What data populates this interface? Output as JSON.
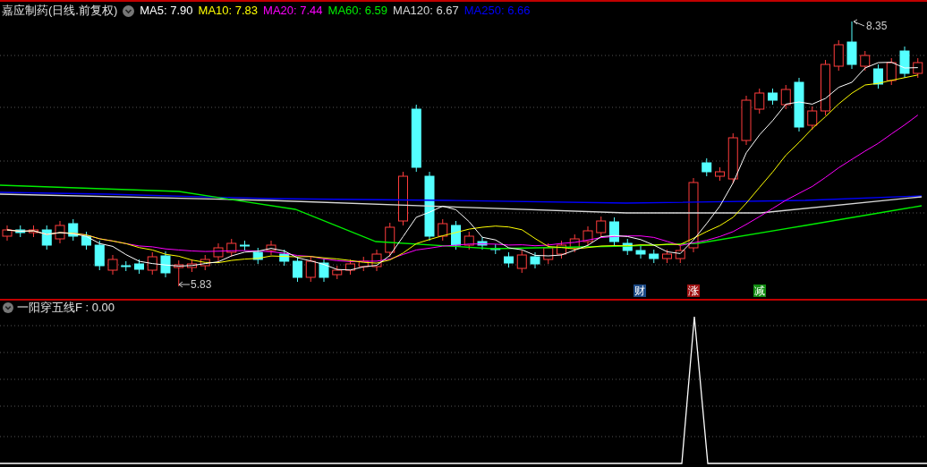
{
  "header": {
    "title": "嘉应制药(日线.前复权)",
    "ma_legends": [
      {
        "label": "MA5: 7.90",
        "color": "#ffffff"
      },
      {
        "label": "MA10: 7.83",
        "color": "#ffff00"
      },
      {
        "label": "MA20: 7.44",
        "color": "#ff00ff"
      },
      {
        "label": "MA60: 6.59",
        "color": "#00ee00"
      },
      {
        "label": "MA120: 6.67",
        "color": "#d8d8d8"
      },
      {
        "label": "MA250: 6.66",
        "color": "#0000ff"
      }
    ]
  },
  "price_chart": {
    "high_label": "8.35",
    "low_label": "5.83",
    "event_markers": [
      {
        "label": "财",
        "color": "#1c4a86"
      },
      {
        "label": "涨",
        "color": "#a01212"
      },
      {
        "label": "减",
        "color": "#118c11"
      }
    ]
  },
  "indicator": {
    "legend": "一阳穿五线F : 0.00"
  }
}
